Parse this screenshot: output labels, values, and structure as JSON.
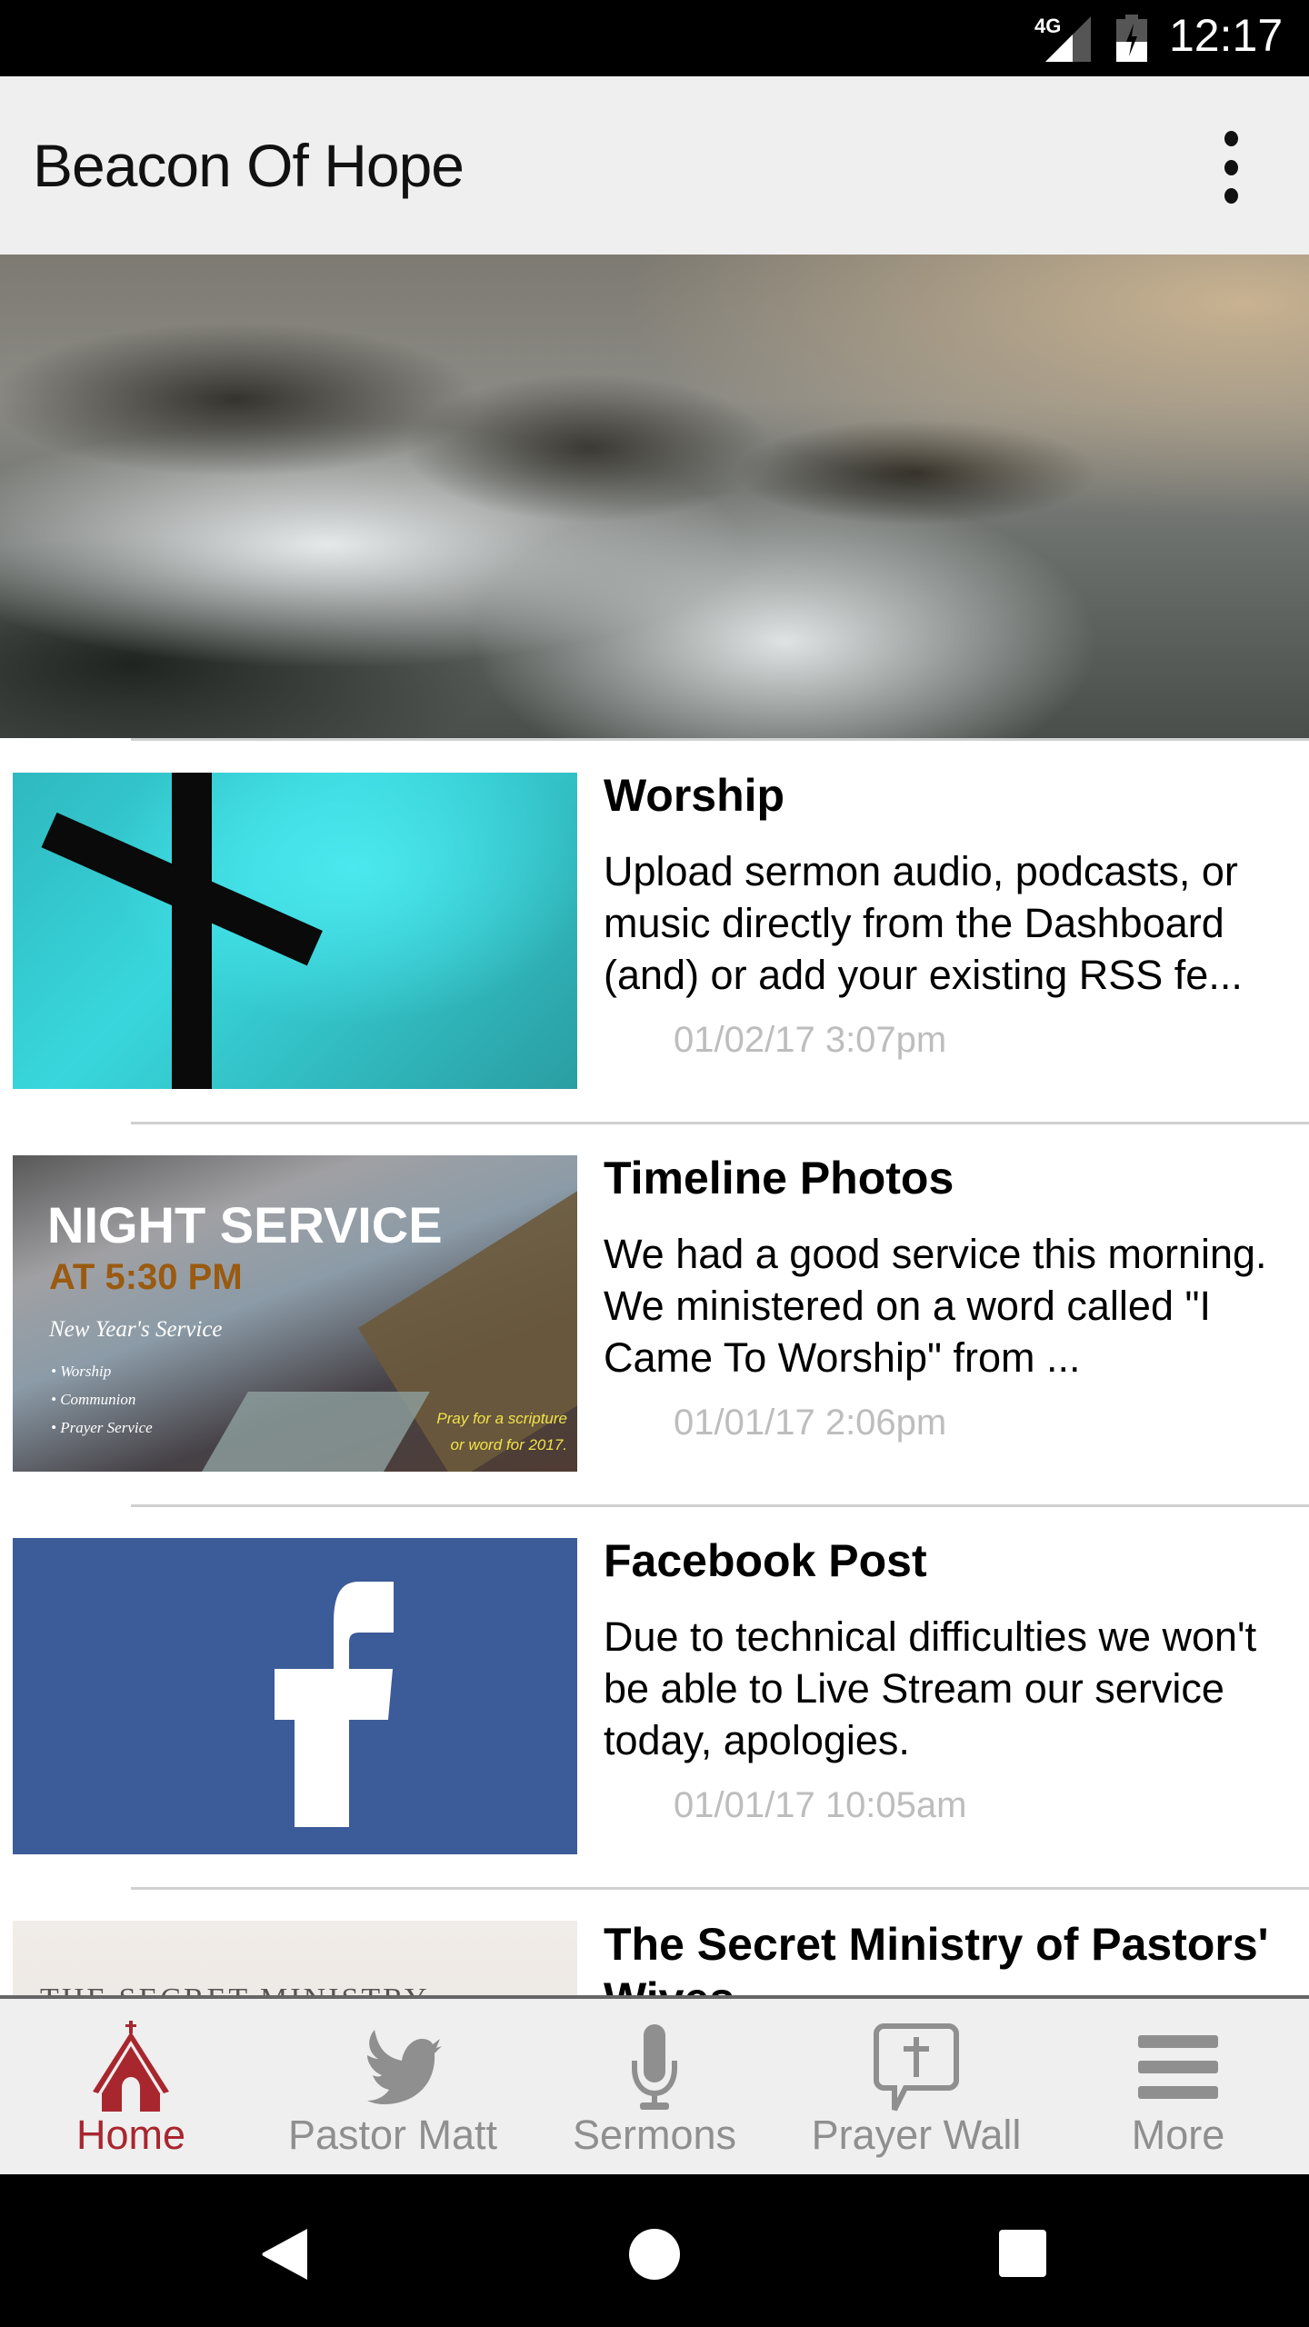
{
  "status_bar": {
    "network": "4G",
    "time": "12:17"
  },
  "app_bar": {
    "title": "Beacon Of Hope",
    "menu_icon": "more-vert-icon"
  },
  "hero": {
    "image": "stormy-sea-rocks-painting"
  },
  "feed": [
    {
      "title": "Worship",
      "description": "Upload sermon audio, podcasts, or music directly from the Dashboard (and) or add your existing RSS fe...",
      "date": "01/02/17 3:07pm",
      "thumbnail": "cross-teal-sky"
    },
    {
      "title": "Timeline Photos",
      "description": "We had a good service this morning. We ministered on a word called \"I Came To Worship\" from ...",
      "date": "01/01/17 2:06pm",
      "thumbnail": "night-service-flyer",
      "thumbnail_text": {
        "headline": "NIGHT SERVICE",
        "time": "AT 5:30 PM",
        "subtitle": "New Year's Service",
        "list": [
          "Worship",
          "Communion",
          "Prayer Service"
        ],
        "note": "Pray for a scripture or word for 2017."
      }
    },
    {
      "title": "Facebook Post",
      "description": "Due to technical difficulties we won't be able to Live Stream our service today, apologies.",
      "date": "01/01/17 10:05am",
      "thumbnail": "facebook-logo"
    },
    {
      "title": "The Secret Ministry of Pastors' Wives",
      "description": "",
      "date": "",
      "thumbnail": "secret-ministry-cover",
      "thumbnail_text": "THE SECRET MINISTRY"
    }
  ],
  "bottom_nav": {
    "tabs": [
      {
        "label": "Home",
        "icon": "church-icon",
        "active": true
      },
      {
        "label": "Pastor Matt",
        "icon": "twitter-bird-icon",
        "active": false
      },
      {
        "label": "Sermons",
        "icon": "microphone-icon",
        "active": false
      },
      {
        "label": "Prayer Wall",
        "icon": "speech-bubble-cross-icon",
        "active": false
      },
      {
        "label": "More",
        "icon": "hamburger-menu-icon",
        "active": false
      }
    ],
    "active_color": "#a8272f",
    "inactive_color": "#8f8f8f"
  },
  "system_nav": {
    "back": "back-icon",
    "home": "home-circle-icon",
    "recents": "recents-square-icon"
  }
}
